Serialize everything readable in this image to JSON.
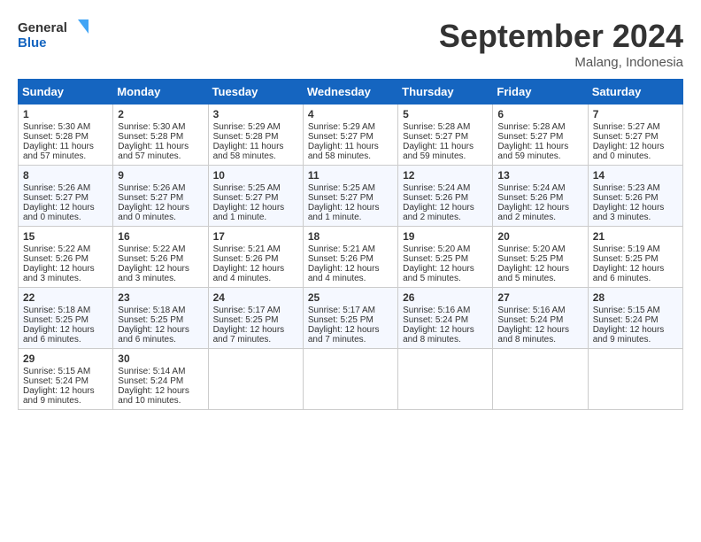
{
  "header": {
    "logo_line1": "General",
    "logo_line2": "Blue",
    "month_title": "September 2024",
    "location": "Malang, Indonesia"
  },
  "days_of_week": [
    "Sunday",
    "Monday",
    "Tuesday",
    "Wednesday",
    "Thursday",
    "Friday",
    "Saturday"
  ],
  "weeks": [
    [
      {
        "day": 1,
        "sunrise": "5:30 AM",
        "sunset": "5:28 PM",
        "daylight": "11 hours and 57 minutes."
      },
      {
        "day": 2,
        "sunrise": "5:30 AM",
        "sunset": "5:28 PM",
        "daylight": "11 hours and 57 minutes."
      },
      {
        "day": 3,
        "sunrise": "5:29 AM",
        "sunset": "5:28 PM",
        "daylight": "11 hours and 58 minutes."
      },
      {
        "day": 4,
        "sunrise": "5:29 AM",
        "sunset": "5:27 PM",
        "daylight": "11 hours and 58 minutes."
      },
      {
        "day": 5,
        "sunrise": "5:28 AM",
        "sunset": "5:27 PM",
        "daylight": "11 hours and 59 minutes."
      },
      {
        "day": 6,
        "sunrise": "5:28 AM",
        "sunset": "5:27 PM",
        "daylight": "11 hours and 59 minutes."
      },
      {
        "day": 7,
        "sunrise": "5:27 AM",
        "sunset": "5:27 PM",
        "daylight": "12 hours and 0 minutes."
      }
    ],
    [
      {
        "day": 8,
        "sunrise": "5:26 AM",
        "sunset": "5:27 PM",
        "daylight": "12 hours and 0 minutes."
      },
      {
        "day": 9,
        "sunrise": "5:26 AM",
        "sunset": "5:27 PM",
        "daylight": "12 hours and 0 minutes."
      },
      {
        "day": 10,
        "sunrise": "5:25 AM",
        "sunset": "5:27 PM",
        "daylight": "12 hours and 1 minute."
      },
      {
        "day": 11,
        "sunrise": "5:25 AM",
        "sunset": "5:27 PM",
        "daylight": "12 hours and 1 minute."
      },
      {
        "day": 12,
        "sunrise": "5:24 AM",
        "sunset": "5:26 PM",
        "daylight": "12 hours and 2 minutes."
      },
      {
        "day": 13,
        "sunrise": "5:24 AM",
        "sunset": "5:26 PM",
        "daylight": "12 hours and 2 minutes."
      },
      {
        "day": 14,
        "sunrise": "5:23 AM",
        "sunset": "5:26 PM",
        "daylight": "12 hours and 3 minutes."
      }
    ],
    [
      {
        "day": 15,
        "sunrise": "5:22 AM",
        "sunset": "5:26 PM",
        "daylight": "12 hours and 3 minutes."
      },
      {
        "day": 16,
        "sunrise": "5:22 AM",
        "sunset": "5:26 PM",
        "daylight": "12 hours and 3 minutes."
      },
      {
        "day": 17,
        "sunrise": "5:21 AM",
        "sunset": "5:26 PM",
        "daylight": "12 hours and 4 minutes."
      },
      {
        "day": 18,
        "sunrise": "5:21 AM",
        "sunset": "5:26 PM",
        "daylight": "12 hours and 4 minutes."
      },
      {
        "day": 19,
        "sunrise": "5:20 AM",
        "sunset": "5:25 PM",
        "daylight": "12 hours and 5 minutes."
      },
      {
        "day": 20,
        "sunrise": "5:20 AM",
        "sunset": "5:25 PM",
        "daylight": "12 hours and 5 minutes."
      },
      {
        "day": 21,
        "sunrise": "5:19 AM",
        "sunset": "5:25 PM",
        "daylight": "12 hours and 6 minutes."
      }
    ],
    [
      {
        "day": 22,
        "sunrise": "5:18 AM",
        "sunset": "5:25 PM",
        "daylight": "12 hours and 6 minutes."
      },
      {
        "day": 23,
        "sunrise": "5:18 AM",
        "sunset": "5:25 PM",
        "daylight": "12 hours and 6 minutes."
      },
      {
        "day": 24,
        "sunrise": "5:17 AM",
        "sunset": "5:25 PM",
        "daylight": "12 hours and 7 minutes."
      },
      {
        "day": 25,
        "sunrise": "5:17 AM",
        "sunset": "5:25 PM",
        "daylight": "12 hours and 7 minutes."
      },
      {
        "day": 26,
        "sunrise": "5:16 AM",
        "sunset": "5:24 PM",
        "daylight": "12 hours and 8 minutes."
      },
      {
        "day": 27,
        "sunrise": "5:16 AM",
        "sunset": "5:24 PM",
        "daylight": "12 hours and 8 minutes."
      },
      {
        "day": 28,
        "sunrise": "5:15 AM",
        "sunset": "5:24 PM",
        "daylight": "12 hours and 9 minutes."
      }
    ],
    [
      {
        "day": 29,
        "sunrise": "5:15 AM",
        "sunset": "5:24 PM",
        "daylight": "12 hours and 9 minutes."
      },
      {
        "day": 30,
        "sunrise": "5:14 AM",
        "sunset": "5:24 PM",
        "daylight": "12 hours and 10 minutes."
      },
      null,
      null,
      null,
      null,
      null
    ]
  ]
}
